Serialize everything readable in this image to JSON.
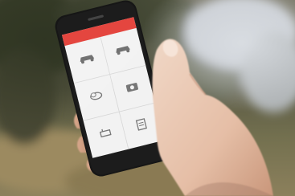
{
  "scene": {
    "subject": "hand-holding-smartphone",
    "app_header_color": "#e2372f",
    "screen_color": "#f2f2f2",
    "phone_color": "#161616"
  },
  "app_screen": {
    "tile_count": 6,
    "tile_icons": [
      "car-icon",
      "car-icon",
      "cloud-icon",
      "camera-icon",
      "tool-icon",
      "document-icon"
    ]
  }
}
